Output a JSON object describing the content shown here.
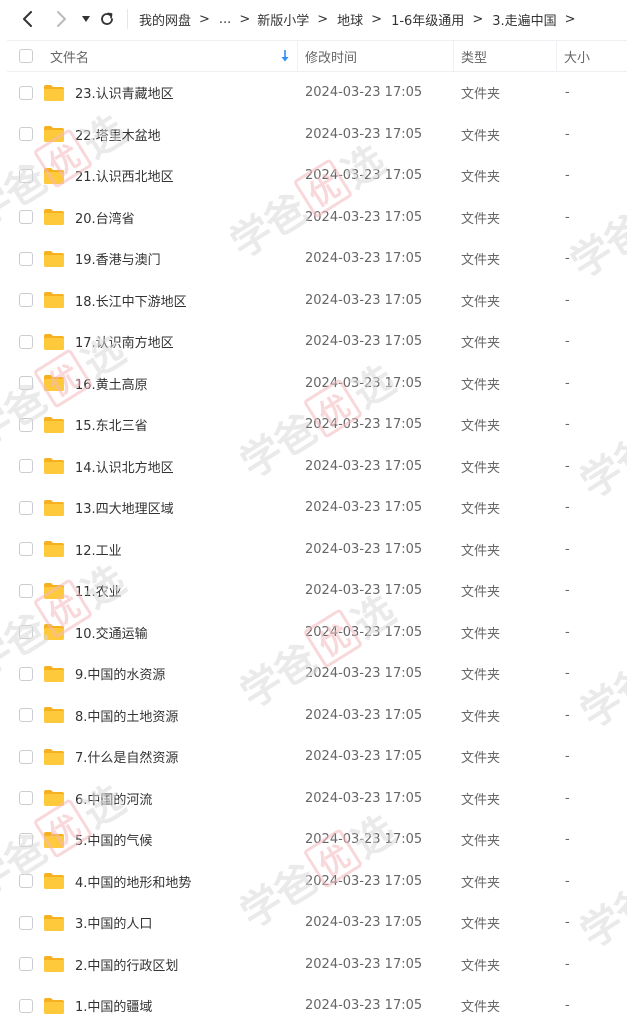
{
  "nav": {
    "back_icon": "chevron-left-icon",
    "forward_icon": "chevron-right-icon",
    "dropdown_icon": "caret-down-icon",
    "refresh_icon": "refresh-icon"
  },
  "breadcrumb": {
    "items": [
      "我的网盘",
      "...",
      "新版小学",
      "地球",
      "1-6年级通用",
      "3.走遍中国"
    ],
    "separator": ">"
  },
  "header": {
    "name": "文件名",
    "modified": "修改时间",
    "type": "类型",
    "size": "大小",
    "sort_icon": "sort-down-arrow-icon"
  },
  "colors": {
    "accent": "#2f8ef7",
    "folder": "#ffc93c",
    "folder_dark": "#f5b120",
    "watermark_red": "#f3b9bd"
  },
  "watermark": {
    "chars": [
      "学",
      "爸",
      "优",
      "选"
    ]
  },
  "files": [
    {
      "name": "23.认识青藏地区",
      "modified": "2024-03-23 17:05",
      "type": "文件夹",
      "size": "-"
    },
    {
      "name": "22.塔里木盆地",
      "modified": "2024-03-23 17:05",
      "type": "文件夹",
      "size": "-"
    },
    {
      "name": "21.认识西北地区",
      "modified": "2024-03-23 17:05",
      "type": "文件夹",
      "size": "-"
    },
    {
      "name": "20.台湾省",
      "modified": "2024-03-23 17:05",
      "type": "文件夹",
      "size": "-"
    },
    {
      "name": "19.香港与澳门",
      "modified": "2024-03-23 17:05",
      "type": "文件夹",
      "size": "-"
    },
    {
      "name": "18.长江中下游地区",
      "modified": "2024-03-23 17:05",
      "type": "文件夹",
      "size": "-"
    },
    {
      "name": "17.认识南方地区",
      "modified": "2024-03-23 17:05",
      "type": "文件夹",
      "size": "-"
    },
    {
      "name": "16.黄土高原",
      "modified": "2024-03-23 17:05",
      "type": "文件夹",
      "size": "-"
    },
    {
      "name": "15.东北三省",
      "modified": "2024-03-23 17:05",
      "type": "文件夹",
      "size": "-"
    },
    {
      "name": "14.认识北方地区",
      "modified": "2024-03-23 17:05",
      "type": "文件夹",
      "size": "-"
    },
    {
      "name": "13.四大地理区域",
      "modified": "2024-03-23 17:05",
      "type": "文件夹",
      "size": "-"
    },
    {
      "name": "12.工业",
      "modified": "2024-03-23 17:05",
      "type": "文件夹",
      "size": "-"
    },
    {
      "name": "11.农业",
      "modified": "2024-03-23 17:05",
      "type": "文件夹",
      "size": "-"
    },
    {
      "name": "10.交通运输",
      "modified": "2024-03-23 17:05",
      "type": "文件夹",
      "size": "-"
    },
    {
      "name": "9.中国的水资源",
      "modified": "2024-03-23 17:05",
      "type": "文件夹",
      "size": "-"
    },
    {
      "name": "8.中国的土地资源",
      "modified": "2024-03-23 17:05",
      "type": "文件夹",
      "size": "-"
    },
    {
      "name": "7.什么是自然资源",
      "modified": "2024-03-23 17:05",
      "type": "文件夹",
      "size": "-"
    },
    {
      "name": "6.中国的河流",
      "modified": "2024-03-23 17:05",
      "type": "文件夹",
      "size": "-"
    },
    {
      "name": "5.中国的气候",
      "modified": "2024-03-23 17:05",
      "type": "文件夹",
      "size": "-"
    },
    {
      "name": "4.中国的地形和地势",
      "modified": "2024-03-23 17:05",
      "type": "文件夹",
      "size": "-"
    },
    {
      "name": "3.中国的人口",
      "modified": "2024-03-23 17:05",
      "type": "文件夹",
      "size": "-"
    },
    {
      "name": "2.中国的行政区划",
      "modified": "2024-03-23 17:05",
      "type": "文件夹",
      "size": "-"
    },
    {
      "name": "1.中国的疆域",
      "modified": "2024-03-23 17:05",
      "type": "文件夹",
      "size": "-"
    }
  ]
}
